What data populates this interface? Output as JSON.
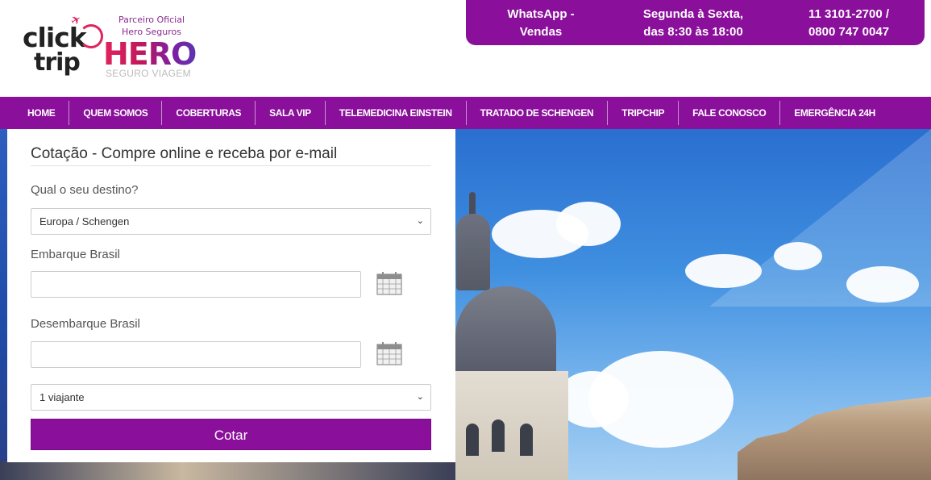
{
  "logo": {
    "click": "click",
    "trip": "trip",
    "partner_line1": "Parceiro Oficial",
    "partner_line2": "Hero Seguros",
    "hero": "HERO",
    "hero_sub": "SEGURO VIAGEM"
  },
  "contact": {
    "whatsapp_line1": "WhatsApp -",
    "whatsapp_line2": "Vendas",
    "hours_line1": "Segunda à Sexta,",
    "hours_line2": "das 8:30 às 18:00",
    "phone_line1": "11 3101-2700 /",
    "phone_line2": "0800 747 0047"
  },
  "nav": {
    "items": [
      "HOME",
      "QUEM SOMOS",
      "COBERTURAS",
      "SALA VIP",
      "TELEMEDICINA EINSTEIN",
      "TRATADO DE SCHENGEN",
      "TRIPCHIP",
      "FALE CONOSCO",
      "EMERGÊNCIA 24H"
    ]
  },
  "form": {
    "title": "Cotação - Compre online e receba por e-mail",
    "destination_label": "Qual o seu destino?",
    "destination_value": "Europa / Schengen",
    "departure_label": "Embarque Brasil",
    "departure_value": "",
    "return_label": "Desembarque Brasil",
    "return_value": "",
    "travelers_value": "1 viajante",
    "submit_label": "Cotar"
  },
  "icons": {
    "calendar": "calendar-icon",
    "caret": "chevron-down-icon",
    "plane": "airplane-icon"
  },
  "colors": {
    "brand_purple": "#8a0f9a",
    "hero_pink": "#e0245e"
  }
}
